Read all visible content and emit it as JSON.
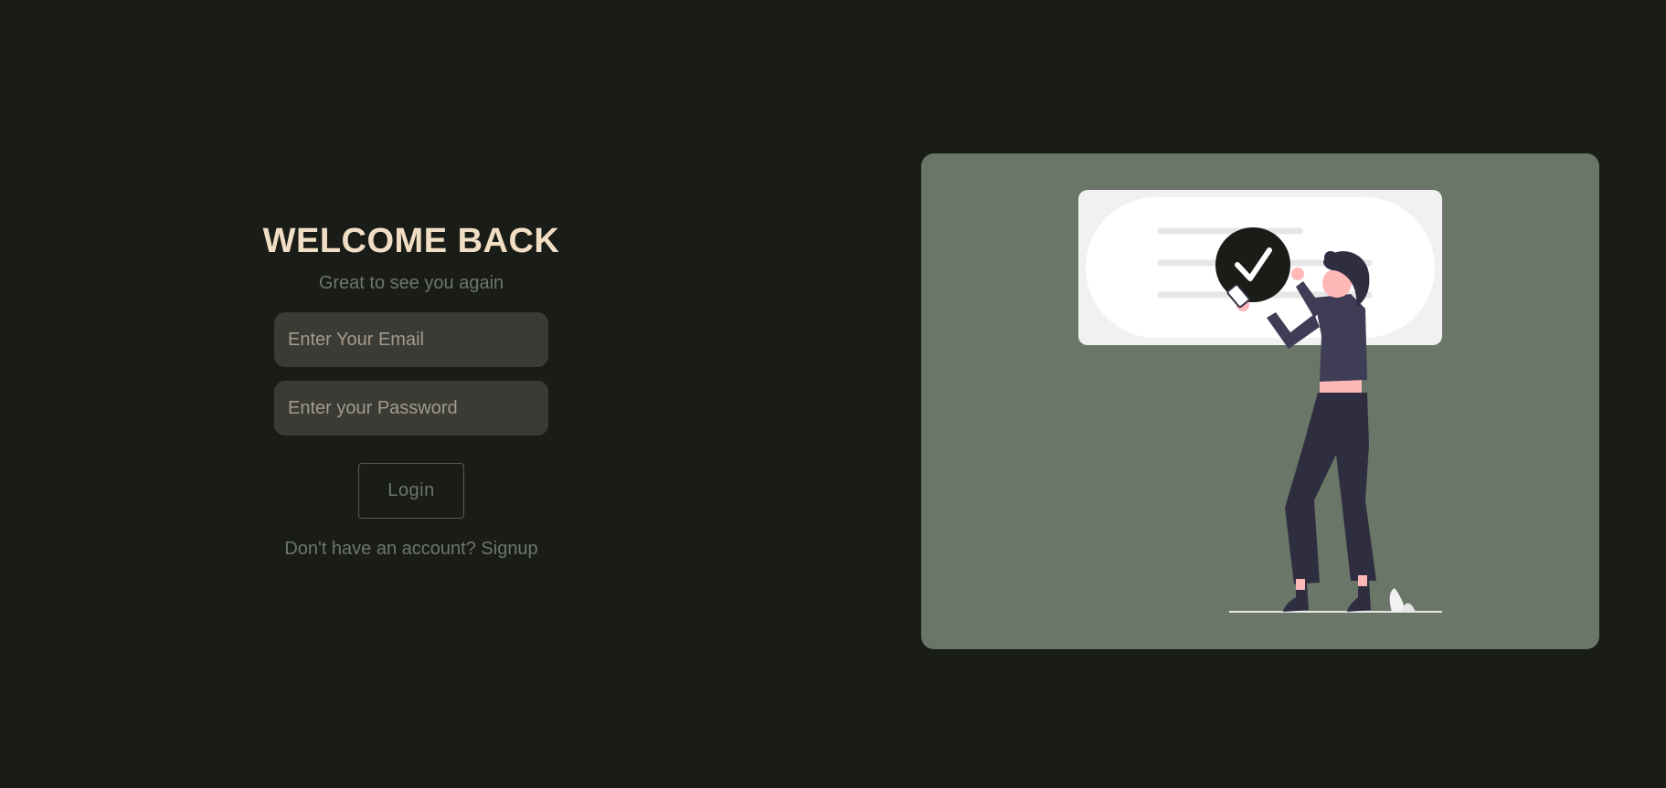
{
  "login": {
    "title": "WELCOME BACK",
    "subtitle": "Great to see you again",
    "email_placeholder": "Enter Your Email",
    "password_placeholder": "Enter your Password",
    "login_label": "Login",
    "signup_prompt": "Don't have an account?",
    "signup_link": "Signup"
  },
  "illustration": {
    "icon": "checkmark-icon",
    "subject": "person-with-phone-illustration"
  },
  "colors": {
    "background": "#1a1c17",
    "title": "#f1dfc5",
    "muted_text": "#6e776a",
    "input_bg": "#3b3b36",
    "card_bg": "#6a7667"
  }
}
